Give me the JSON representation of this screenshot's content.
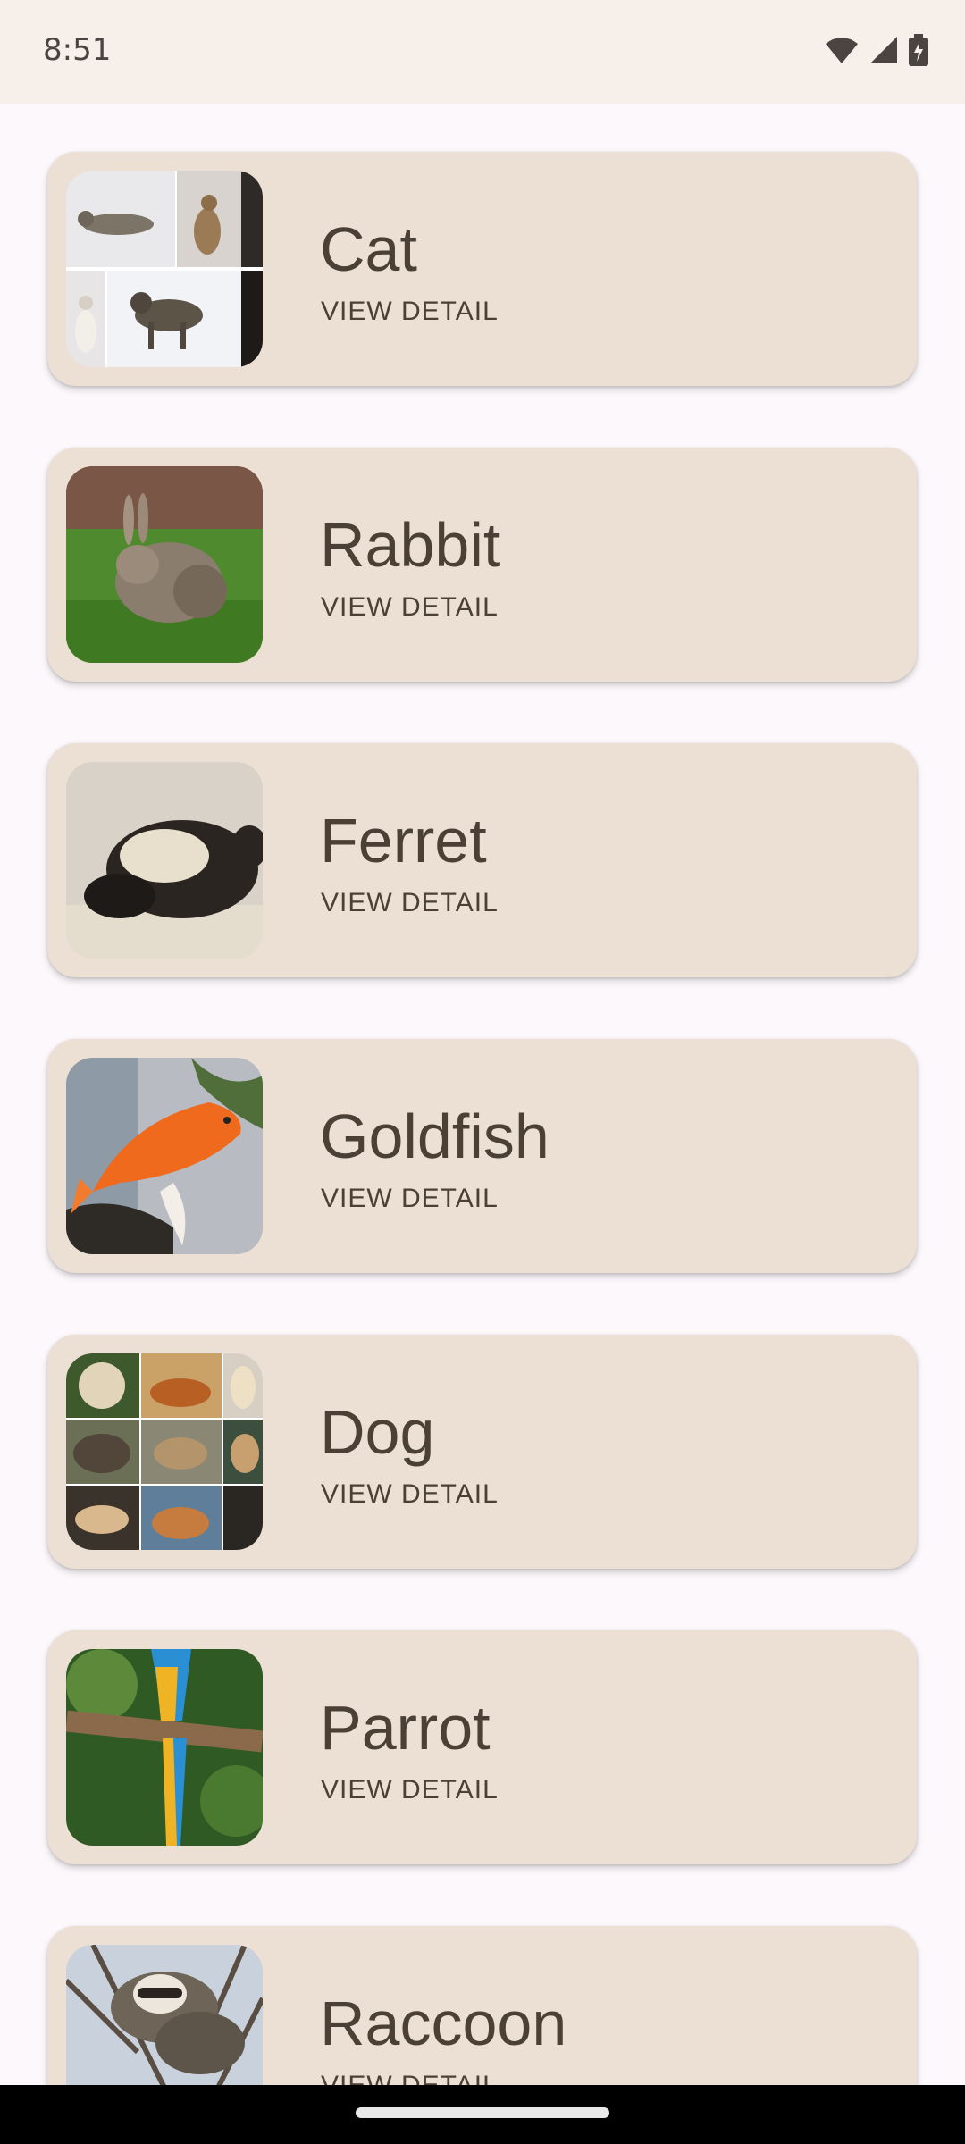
{
  "status_bar": {
    "time": "8:51",
    "icons": [
      "wifi-icon",
      "cellular-signal-icon",
      "battery-charging-icon"
    ]
  },
  "animals": [
    {
      "name": "Cat",
      "action": "VIEW DETAIL",
      "image": "cat-collage"
    },
    {
      "name": "Rabbit",
      "action": "VIEW DETAIL",
      "image": "rabbit"
    },
    {
      "name": "Ferret",
      "action": "VIEW DETAIL",
      "image": "ferret"
    },
    {
      "name": "Goldfish",
      "action": "VIEW DETAIL",
      "image": "goldfish"
    },
    {
      "name": "Dog",
      "action": "VIEW DETAIL",
      "image": "dog-collage"
    },
    {
      "name": "Parrot",
      "action": "VIEW DETAIL",
      "image": "parrot"
    },
    {
      "name": "Raccoon",
      "action": "VIEW DETAIL",
      "image": "raccoon"
    }
  ],
  "colors": {
    "status_bar_bg": "#f7efe9",
    "page_bg": "#fcf8fb",
    "card_bg": "#ecdfd3",
    "text": "#4a4035"
  }
}
